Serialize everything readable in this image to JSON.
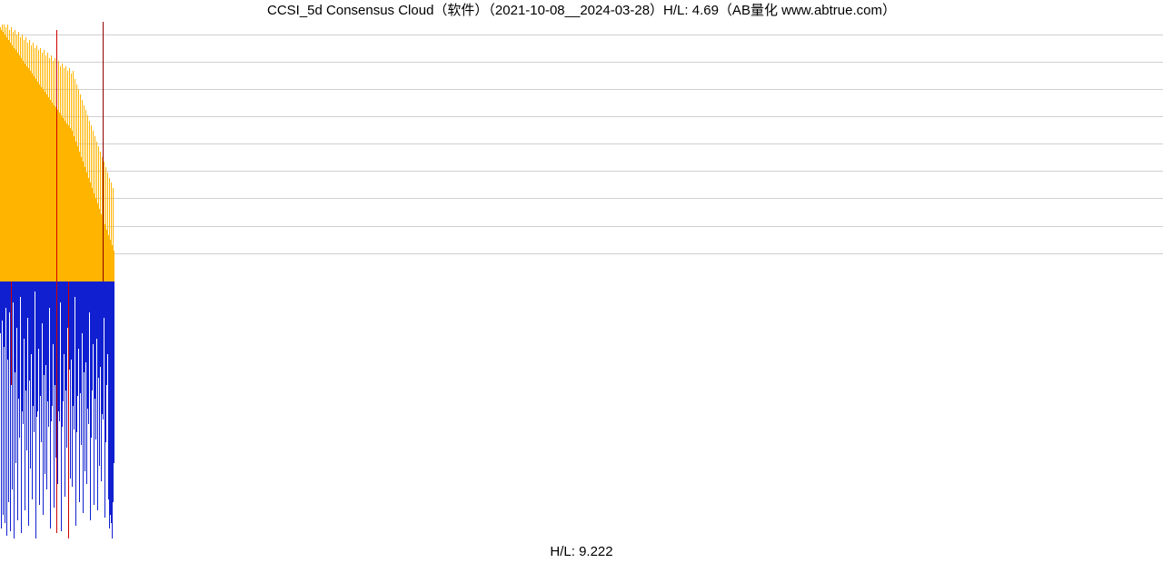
{
  "title": "CCSI_5d Consensus Cloud（软件）（2021-10-08__2024-03-28）H/L: 4.69（AB量化  www.abtrue.com）",
  "footer": "H/L: 9.222",
  "chart_data": {
    "type": "bar",
    "title": "CCSI_5d Consensus Cloud（软件）（2021-10-08__2024-03-28）H/L: 4.69（AB量化  www.abtrue.com）",
    "subtitle": "H/L: 9.222",
    "x_range_note": "bars occupy roughly the first ~10% of the horizontal extent; rest blank",
    "x_total_slots": 1280,
    "x_first_bar_index": 0,
    "x_last_bar_index": 125,
    "upper_panel": {
      "ylim": [
        0,
        100
      ],
      "gridline_percents": [
        5,
        15.5,
        26,
        36.5,
        47,
        57.5,
        68,
        78.5,
        89
      ],
      "color": "#ffb400",
      "highlight_color": "#d00000",
      "highlight_index": 62,
      "values_percent_height": [
        98,
        97,
        99,
        96,
        99,
        95,
        98,
        94,
        99,
        93,
        97,
        92,
        98,
        91,
        96,
        90,
        97,
        89,
        95,
        88,
        96,
        87,
        94,
        86,
        95,
        85,
        93,
        84,
        94,
        83,
        92,
        82,
        93,
        81,
        91,
        80,
        92,
        79,
        90,
        78,
        91,
        77,
        89,
        76,
        90,
        75,
        88,
        74,
        89,
        73,
        87,
        72,
        88,
        71,
        86,
        70,
        87,
        69,
        85,
        68,
        86,
        67,
        97,
        66,
        85,
        65,
        83,
        64,
        84,
        63,
        82,
        62,
        83,
        61,
        81,
        60,
        82,
        59,
        80,
        58,
        81,
        56,
        78,
        54,
        76,
        52,
        74,
        50,
        72,
        48,
        70,
        46,
        68,
        44,
        66,
        42,
        64,
        40,
        62,
        38,
        60,
        36,
        58,
        34,
        56,
        32,
        54,
        30,
        52,
        28,
        50,
        26,
        48,
        24,
        46,
        22,
        44,
        20,
        42,
        18,
        40,
        16,
        38,
        14,
        36,
        12
      ],
      "vertical_guide_index": 113
    },
    "lower_panel": {
      "ylim": [
        0,
        100
      ],
      "color": "#1020d0",
      "highlight_color": "#d00000",
      "highlight_indices": [
        12,
        62,
        75
      ],
      "values_percent_depth": [
        20,
        95,
        15,
        90,
        25,
        93,
        10,
        98,
        30,
        85,
        12,
        96,
        40,
        80,
        8,
        99,
        35,
        70,
        18,
        92,
        45,
        60,
        6,
        97,
        50,
        55,
        22,
        88,
        42,
        65,
        14,
        94,
        38,
        72,
        28,
        84,
        48,
        58,
        4,
        99,
        52,
        50,
        26,
        86,
        44,
        62,
        16,
        90,
        36,
        74,
        32,
        80,
        46,
        56,
        10,
        95,
        54,
        48,
        24,
        87,
        40,
        68,
        97,
        78,
        50,
        54,
        8,
        96,
        56,
        46,
        28,
        83,
        42,
        64,
        18,
        99,
        34,
        76,
        30,
        79,
        48,
        57,
        6,
        94,
        58,
        44,
        26,
        85,
        43,
        63,
        20,
        89,
        35,
        73,
        31,
        78,
        49,
        55,
        12,
        92,
        60,
        42,
        24,
        86,
        45,
        61,
        22,
        88,
        37,
        71,
        33,
        77,
        51,
        53,
        14,
        91,
        62,
        40,
        28,
        84,
        95,
        90,
        93,
        99,
        85,
        70
      ]
    }
  }
}
